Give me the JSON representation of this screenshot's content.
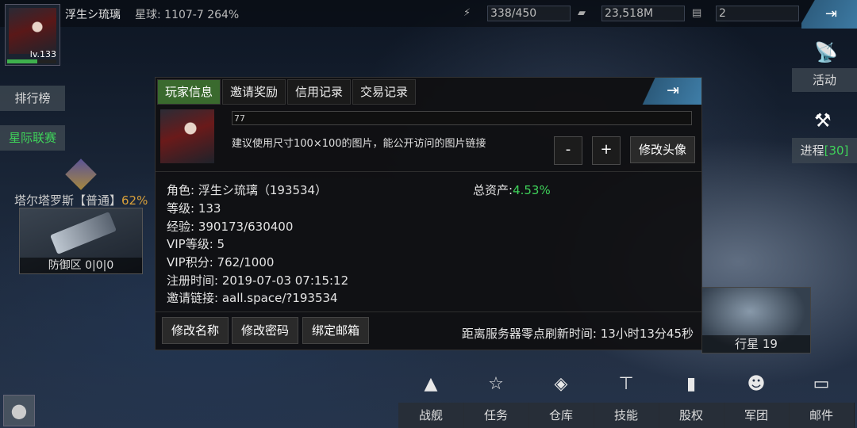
{
  "player": {
    "name": "浮生シ琉璃",
    "planet": "星球: 1107-7  264%",
    "level": "lv.133"
  },
  "stats": {
    "energy": "338/450",
    "money": "23,518M",
    "cards": "2"
  },
  "left": {
    "ranking": "排行榜",
    "alliance": "星际联赛",
    "alliance_name": "塔尔塔罗斯【普通】",
    "alliance_pct": "62%",
    "defense": "防御区 0|0|0"
  },
  "right": {
    "activity": "活动",
    "progress": "进程",
    "progress_count": "[30]",
    "planet": "行星 19"
  },
  "nav": [
    "战舰",
    "任务",
    "仓库",
    "技能",
    "股权",
    "军团",
    "邮件"
  ],
  "modal": {
    "tabs": [
      "玩家信息",
      "邀请奖励",
      "信用记录",
      "交易记录"
    ],
    "avatar_url": "77",
    "avatar_hint": "建议使用尺寸100×100的图片，能公开访问的图片链接",
    "minus": "-",
    "plus": "+",
    "change_avatar": "修改头像",
    "role": "角色: 浮生シ琉璃（193534）",
    "level": "等级: 133",
    "exp": "经验: 390173/630400",
    "vip": "VIP等级: 5",
    "vip_points": "VIP积分: 762/1000",
    "register": "注册时间: 2019-07-03 07:15:12",
    "invite": "邀请链接: aall.space/?193534",
    "assets_label": "总资产:",
    "assets_value": "4.53%",
    "buttons": [
      "修改名称",
      "修改密码",
      "绑定邮箱"
    ],
    "refresh": "距离服务器零点刷新时间: 13小时13分45秒"
  }
}
